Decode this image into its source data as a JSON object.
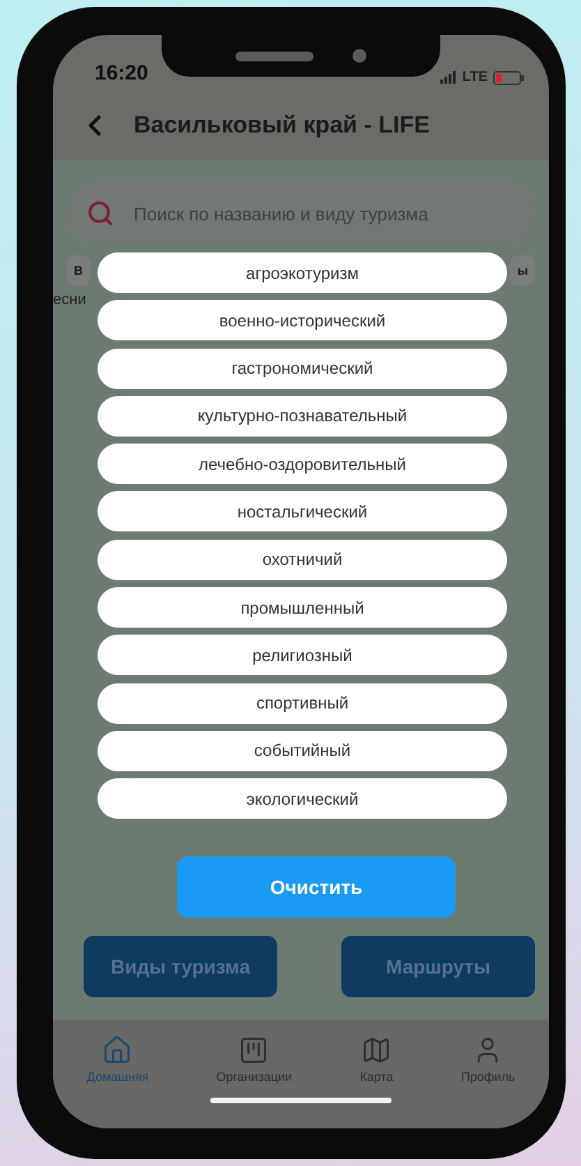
{
  "status_bar": {
    "time": "16:20",
    "network": "LTE"
  },
  "header": {
    "title": "Васильковый край - LIFE"
  },
  "search": {
    "placeholder": "Поиск по названию и виду туризма"
  },
  "chip_fragments": [
    "В",
    "ы"
  ],
  "map_label": "есни",
  "tourism_types": [
    {
      "label": "агроэкотуризм"
    },
    {
      "label": "военно-исторический"
    },
    {
      "label": "гастрономический"
    },
    {
      "label": "культурно-познавательный"
    },
    {
      "label": "лечебно-оздоровительный"
    },
    {
      "label": "ностальгический"
    },
    {
      "label": "охотничий"
    },
    {
      "label": "промышленный"
    },
    {
      "label": "религиозный"
    },
    {
      "label": "спортивный"
    },
    {
      "label": "событийный"
    },
    {
      "label": "экологический"
    }
  ],
  "clear_button": "Очистить",
  "action_buttons": [
    "Виды туризма",
    "Маршруты"
  ],
  "tab_bar": [
    {
      "kind": "home",
      "label": "Домашняя",
      "selected": true
    },
    {
      "kind": "orgs",
      "label": "Организации",
      "selected": false
    },
    {
      "kind": "map",
      "label": "Карта",
      "selected": false
    },
    {
      "kind": "profile",
      "label": "Профиль",
      "selected": false
    }
  ]
}
